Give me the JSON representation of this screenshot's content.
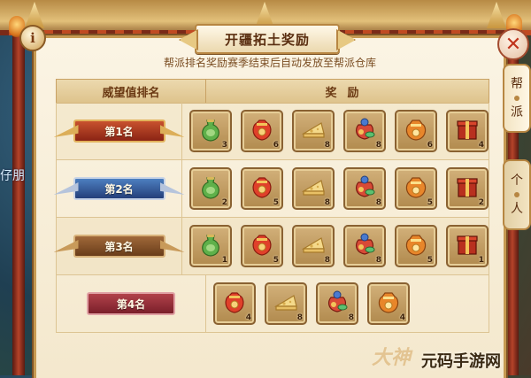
{
  "window": {
    "title": "开疆拓土奖励",
    "subtitle": "帮派排名奖励赛季结束后自动发放至帮派仓库",
    "info_label": "i",
    "close_label": "✕"
  },
  "side_tabs": [
    {
      "label_top": "帮",
      "label_bottom": "派",
      "active": true
    },
    {
      "label_top": "个",
      "label_bottom": "人",
      "active": false
    }
  ],
  "background": {
    "side_text": "仔朋"
  },
  "table": {
    "headers": {
      "rank": "威望值排名",
      "reward": "奖励"
    },
    "rows": [
      {
        "rank": "第1名",
        "items": [
          {
            "icon": "green-gourd-bag-icon",
            "qty": "3"
          },
          {
            "icon": "red-lucky-bag-icon",
            "qty": "6"
          },
          {
            "icon": "cheese-wedge-icon",
            "qty": "8"
          },
          {
            "icon": "treasure-pouch-icon",
            "qty": "8"
          },
          {
            "icon": "gold-lucky-bag-icon",
            "qty": "6"
          },
          {
            "icon": "red-gift-box-icon",
            "qty": "4"
          }
        ]
      },
      {
        "rank": "第2名",
        "items": [
          {
            "icon": "green-gourd-bag-icon",
            "qty": "2"
          },
          {
            "icon": "red-lucky-bag-icon",
            "qty": "5"
          },
          {
            "icon": "cheese-wedge-icon",
            "qty": "8"
          },
          {
            "icon": "treasure-pouch-icon",
            "qty": "8"
          },
          {
            "icon": "gold-lucky-bag-icon",
            "qty": "5"
          },
          {
            "icon": "red-gift-box-icon",
            "qty": "2"
          }
        ]
      },
      {
        "rank": "第3名",
        "items": [
          {
            "icon": "green-gourd-bag-icon",
            "qty": "1"
          },
          {
            "icon": "red-lucky-bag-icon",
            "qty": "5"
          },
          {
            "icon": "cheese-wedge-icon",
            "qty": "8"
          },
          {
            "icon": "treasure-pouch-icon",
            "qty": "8"
          },
          {
            "icon": "gold-lucky-bag-icon",
            "qty": "5"
          },
          {
            "icon": "red-gift-box-icon",
            "qty": "1"
          }
        ]
      },
      {
        "rank": "第4名",
        "items": [
          {
            "icon": "red-lucky-bag-icon",
            "qty": "4"
          },
          {
            "icon": "cheese-wedge-icon",
            "qty": "8"
          },
          {
            "icon": "treasure-pouch-icon",
            "qty": "8"
          },
          {
            "icon": "gold-lucky-bag-icon",
            "qty": "4"
          }
        ]
      }
    ]
  },
  "watermark": {
    "text": "元码手游网",
    "logo": "大神"
  },
  "colors": {
    "panel_bg": "#fbf4e4",
    "frame": "#c69a52",
    "rank1": "#8a2414",
    "rank2": "#243f7a",
    "rank3": "#6a3d1a",
    "rank4": "#7a1f2a"
  }
}
